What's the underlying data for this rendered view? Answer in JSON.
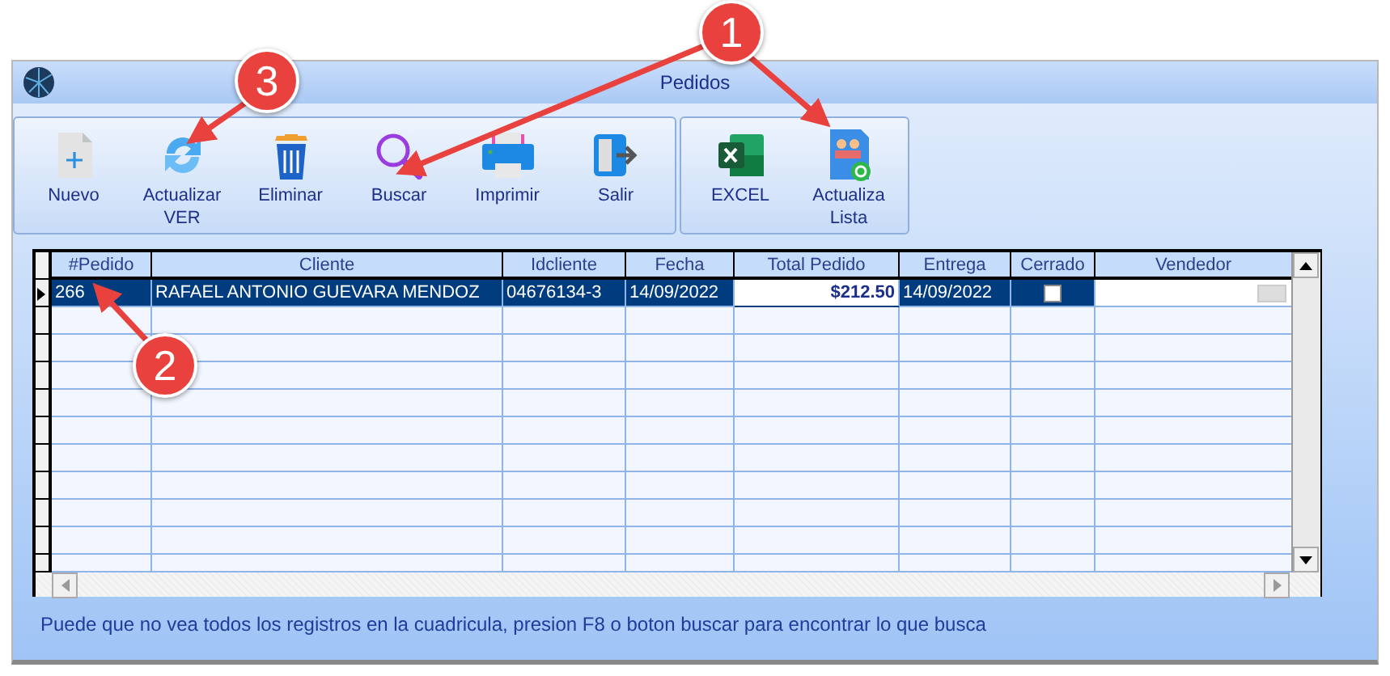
{
  "window": {
    "title": "Pedidos"
  },
  "toolbar_groups": [
    {
      "buttons": [
        {
          "label": "Nuevo"
        },
        {
          "label": "Actualizar VER"
        },
        {
          "label": "Eliminar"
        },
        {
          "label": "Buscar"
        },
        {
          "label": "Imprimir"
        },
        {
          "label": "Salir"
        }
      ]
    },
    {
      "buttons": [
        {
          "label": "EXCEL"
        },
        {
          "label": "Actualiza Lista"
        }
      ]
    }
  ],
  "table": {
    "columns": [
      "#Pedido",
      "Cliente",
      "Idcliente",
      "Fecha",
      "Total Pedido",
      "Entrega",
      "Cerrado",
      "Vendedor"
    ],
    "rows": [
      {
        "selected": true,
        "cells": [
          {
            "kind": "text",
            "text": "266"
          },
          {
            "kind": "text",
            "text": "RAFAEL ANTONIO GUEVARA MENDOZ"
          },
          {
            "kind": "text",
            "text": "04676134-3"
          },
          {
            "kind": "text",
            "text": "14/09/2022"
          },
          {
            "kind": "edit",
            "text": "$212.50"
          },
          {
            "kind": "text",
            "text": "14/09/2022"
          },
          {
            "kind": "check",
            "checked": false
          },
          {
            "kind": "combo"
          }
        ]
      }
    ]
  },
  "status_bar": "Puede que no vea todos los registros en la cuadricula, presion F8 o boton buscar para encontrar lo que busca",
  "callouts": [
    {
      "label": "1"
    },
    {
      "label": "3"
    },
    {
      "label": "2"
    }
  ]
}
